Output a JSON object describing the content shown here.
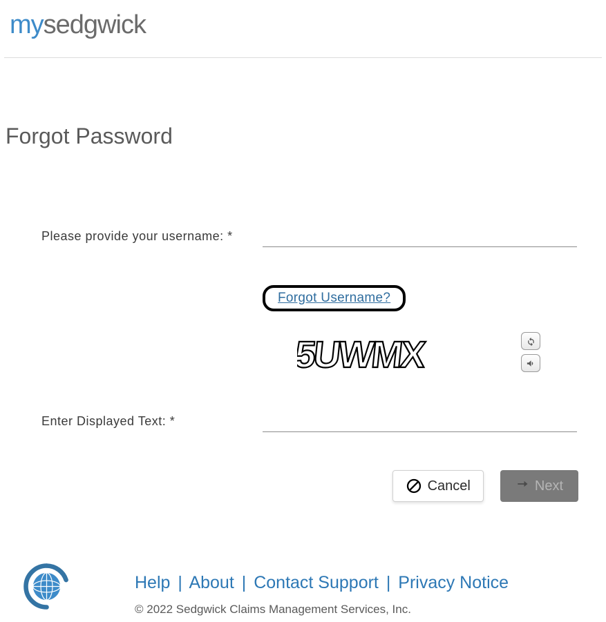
{
  "logo": {
    "prefix": "my",
    "suffix": "sedgwick"
  },
  "page_title": "Forgot Password",
  "form": {
    "username_label": "Please provide your username: *",
    "username_value": "",
    "forgot_username_link": "Forgot Username?",
    "captcha_text": "5UWMX",
    "captcha_label": "Enter Displayed Text: *",
    "captcha_value": ""
  },
  "actions": {
    "cancel": "Cancel",
    "next": "Next"
  },
  "footer": {
    "links": {
      "help": "Help",
      "about": "About",
      "contact": "Contact Support",
      "privacy": "Privacy Notice"
    },
    "copyright": "© 2022 Sedgwick Claims Management Services, Inc."
  }
}
